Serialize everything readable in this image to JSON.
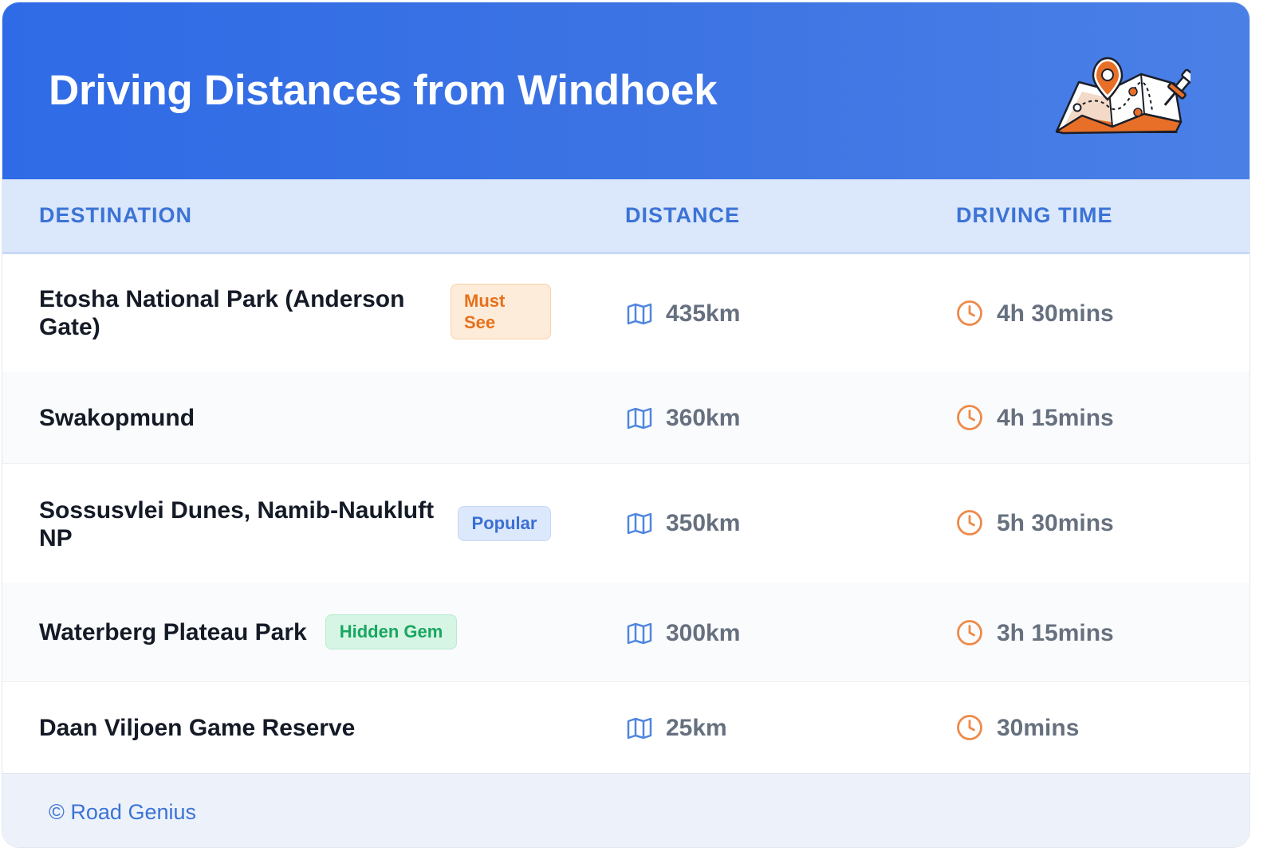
{
  "header": {
    "title": "Driving Distances from Windhoek",
    "illustration_icon": "map-with-pin-icon"
  },
  "columns": {
    "destination": "DESTINATION",
    "distance": "DISTANCE",
    "driving_time": "DRIVING TIME"
  },
  "rows": [
    {
      "destination": "Etosha National Park (Anderson Gate)",
      "badge": "Must See",
      "distance": "435km",
      "time": "4h 30mins"
    },
    {
      "destination": "Swakopmund",
      "badge": "",
      "distance": "360km",
      "time": "4h 15mins"
    },
    {
      "destination": "Sossusvlei Dunes, Namib-Naukluft NP",
      "badge": "Popular",
      "distance": "350km",
      "time": "5h 30mins"
    },
    {
      "destination": "Waterberg Plateau Park",
      "badge": "Hidden Gem",
      "distance": "300km",
      "time": "3h 15mins"
    },
    {
      "destination": "Daan Viljoen Game Reserve",
      "badge": "",
      "distance": "25km",
      "time": "30mins"
    }
  ],
  "footer": {
    "text": "© Road Genius"
  },
  "colors": {
    "header_bg": "#3170e5",
    "header_text": "#ffffff",
    "column_header_bg": "#dbe7fb",
    "column_header_text": "#3b73d6",
    "badge_must_see": "#e6711c",
    "badge_popular": "#3a6fd3",
    "badge_hidden_gem": "#1aa660",
    "distance_icon": "#4f86e0",
    "time_icon": "#ee8a4a"
  },
  "icons": {
    "distance": "map-icon",
    "time": "clock-icon"
  }
}
